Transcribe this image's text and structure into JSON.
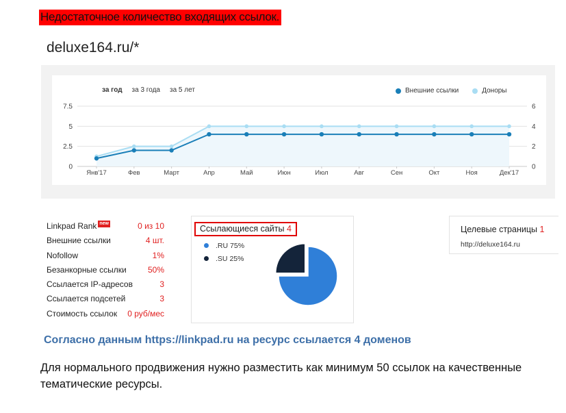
{
  "alert_text": "Недостаточное количество входящих ссылок.",
  "domain_title": "deluxe164.ru/*",
  "period_tabs": [
    "за год",
    "за 3 года",
    "за 5 лет"
  ],
  "chart_data": {
    "type": "line",
    "categories": [
      "Янв'17",
      "Фев",
      "Март",
      "Апр",
      "Май",
      "Июн",
      "Июл",
      "Авг",
      "Сен",
      "Окт",
      "Ноя",
      "Дек'17"
    ],
    "series": [
      {
        "name": "Внешние ссылки",
        "axis": "left",
        "color": "#1a7fb8",
        "values": [
          1,
          2,
          2,
          4,
          4,
          4,
          4,
          4,
          4,
          4,
          4,
          4
        ]
      },
      {
        "name": "Доноры",
        "axis": "right",
        "color": "#a9ddf3",
        "values": [
          1,
          2,
          2,
          4,
          4,
          4,
          4,
          4,
          4,
          4,
          4,
          4
        ]
      }
    ],
    "y_left": {
      "ticks": [
        "0",
        "2.5",
        "5",
        "7.5"
      ],
      "range": [
        0,
        7.5
      ]
    },
    "y_right": {
      "ticks": [
        "0",
        "2",
        "4",
        "6"
      ],
      "range": [
        0,
        6
      ]
    },
    "grid": true,
    "legend_position": "top-right"
  },
  "stats": [
    {
      "label": "Linkpad Rank",
      "value": "0 из 10",
      "badge": "new"
    },
    {
      "label": "Внешние ссылки",
      "value": "4 шт."
    },
    {
      "label": "Nofollow",
      "value": "1%"
    },
    {
      "label": "Безанкорные ссылки",
      "value": "50%"
    },
    {
      "label": "Ссылается IP-адресов",
      "value": "3"
    },
    {
      "label": "Ссылается подсетей",
      "value": "3"
    },
    {
      "label": "Стоимость ссылок",
      "value": "0 руб/мес"
    }
  ],
  "pie": {
    "title": "Ссылающиеся сайты",
    "count": "4",
    "slices": [
      {
        "label": ".RU",
        "percent_text": "75%",
        "value": 75,
        "color": "#2f7fd8"
      },
      {
        "label": ".SU",
        "percent_text": "25%",
        "value": 25,
        "color": "#14243a"
      }
    ]
  },
  "target": {
    "title": "Целевые страницы",
    "count": "1",
    "url": "http://deluxe164.ru"
  },
  "summary": "Согласно данным https://linkpad.ru на ресурс ссылается 4 доменов",
  "body_text": "Для нормального продвижения нужно разместить как минимум 50 ссылок на качественные тематические ресурсы."
}
